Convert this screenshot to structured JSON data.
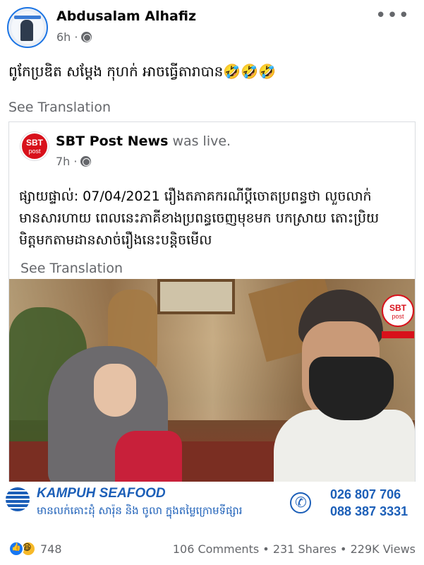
{
  "post": {
    "author": "Abdusalam Alhafiz",
    "time": "6h",
    "text": "ពូកែប្រឌិត សម្ដែង កុហក់ អាចធ្វើតារាបាន🤣🤣🤣",
    "see_translation": "See Translation"
  },
  "shared": {
    "page_name": "SBT Post News",
    "action": "was live.",
    "time": "7h",
    "logo_text": "SBT",
    "logo_sub": "post",
    "text": "ផ្សាយផ្ទាល់: 07/04/2021 រឿងតភាគករណីប្ដីចោតប្រពន្ធថា លួចលាក់មានសារហាយ ពេលនេះភាគីខាងប្រពន្ធចេញមុខមក បកស្រាយ តោះប្រិយមិត្តមកតាមដានសាច់រឿងនេះបន្តិចមើល",
    "see_translation": "See Translation",
    "video_badge": "SBT",
    "video_badge_sub": "post"
  },
  "ad": {
    "title": "KAMPUH SEAFOOD",
    "subtitle": "មានលក់គោះដុំ សារ៉ុន និង ចូលា ក្នុងតម្លៃក្រោមទីផ្សារ",
    "phone1": "026 807 706",
    "phone2": "088 387 3331"
  },
  "footer": {
    "reactions_count": "748",
    "comments": "106 Comments",
    "shares": "231 Shares",
    "views": "229K Views"
  }
}
